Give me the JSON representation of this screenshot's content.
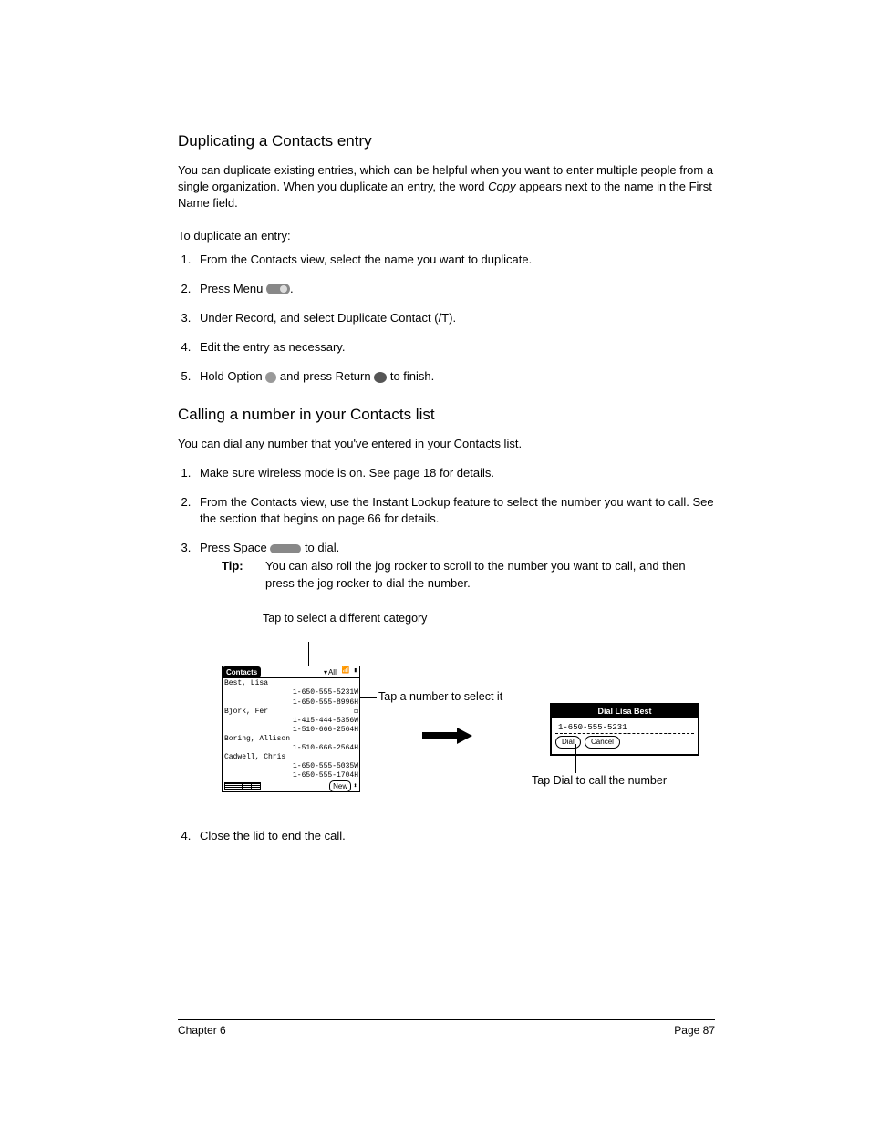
{
  "section1": {
    "heading": "Duplicating a Contacts entry",
    "intro_a": "You can duplicate existing entries, which can be helpful when you want to enter multiple people from a single organization. When you duplicate an entry, the word ",
    "intro_italic": "Copy",
    "intro_b": " appears next to the name in the First Name field.",
    "subhead": "To duplicate an entry:",
    "step1": "From the Contacts view, select the name you want to duplicate.",
    "step2a": "Press Menu ",
    "step2b": ".",
    "step3": "Under Record, and select Duplicate Contact (/T).",
    "step4": "Edit the entry as necessary.",
    "step5a": "Hold Option ",
    "step5b": " and press Return ",
    "step5c": " to finish."
  },
  "section2": {
    "heading": "Calling a number in your Contacts list",
    "intro": "You can dial any number that you've entered in your Contacts list.",
    "step1": "Make sure wireless mode is on. See page 18 for details.",
    "step2": "From the Contacts view, use the Instant Lookup feature to select the number you want to call. See the section that begins on page 66 for details.",
    "step3a": "Press Space ",
    "step3b": " to dial.",
    "tip_label": "Tip:",
    "tip_body": "You can also roll the jog rocker to scroll to the number you want to call, and then press the jog rocker to dial the number.",
    "step4": "Close the lid to end the call."
  },
  "figure": {
    "callout_category": "Tap to select a different category",
    "callout_number": "Tap a number to select it",
    "callout_dial": "Tap Dial to call the number",
    "contacts_title": "Contacts",
    "category_label": "All",
    "rows": {
      "r0": {
        "name": "Best, Lisa",
        "n1": "1-650-555-5231W",
        "n2": "1-650-555-8996H"
      },
      "r1": {
        "name": "Bjork, Fer",
        "n1": "1-415-444-5356W",
        "n2": "1-510-666-2564H"
      },
      "r2": {
        "name": "Boring, Allison",
        "n1": "1-510-666-2564H"
      },
      "r3": {
        "name": "Cadwell, Chris",
        "n1": "1-650-555-5035W",
        "n2": "1-650-555-1704H"
      }
    },
    "new_btn": "New",
    "dial_title": "Dial Lisa Best",
    "dial_number": "1-650-555-5231",
    "dial_btn": "Dial",
    "cancel_btn": "Cancel"
  },
  "footer": {
    "left": "Chapter 6",
    "right": "Page 87"
  }
}
